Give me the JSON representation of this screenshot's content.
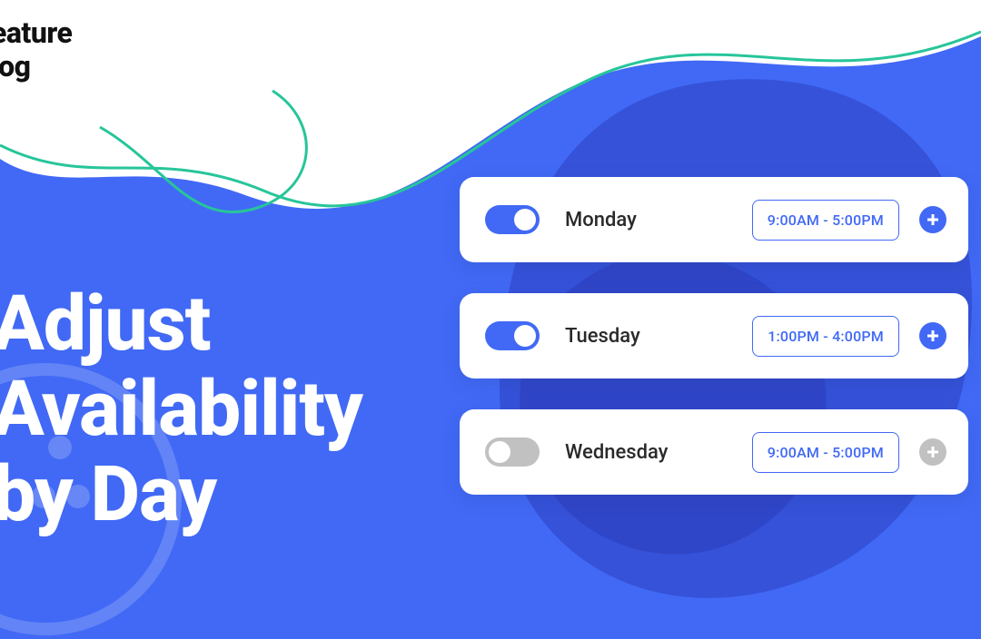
{
  "header": {
    "label_line1": "eature",
    "label_line2": "log"
  },
  "hero": {
    "line1": "Adjust",
    "line2": "Availability",
    "line3": "by Day"
  },
  "colors": {
    "primary": "#4169f5",
    "disabled": "#c1c1c1"
  },
  "days": [
    {
      "name": "Monday",
      "enabled": true,
      "time": "9:00AM - 5:00PM"
    },
    {
      "name": "Tuesday",
      "enabled": true,
      "time": "1:00PM - 4:00PM"
    },
    {
      "name": "Wednesday",
      "enabled": false,
      "time": "9:00AM - 5:00PM"
    }
  ]
}
